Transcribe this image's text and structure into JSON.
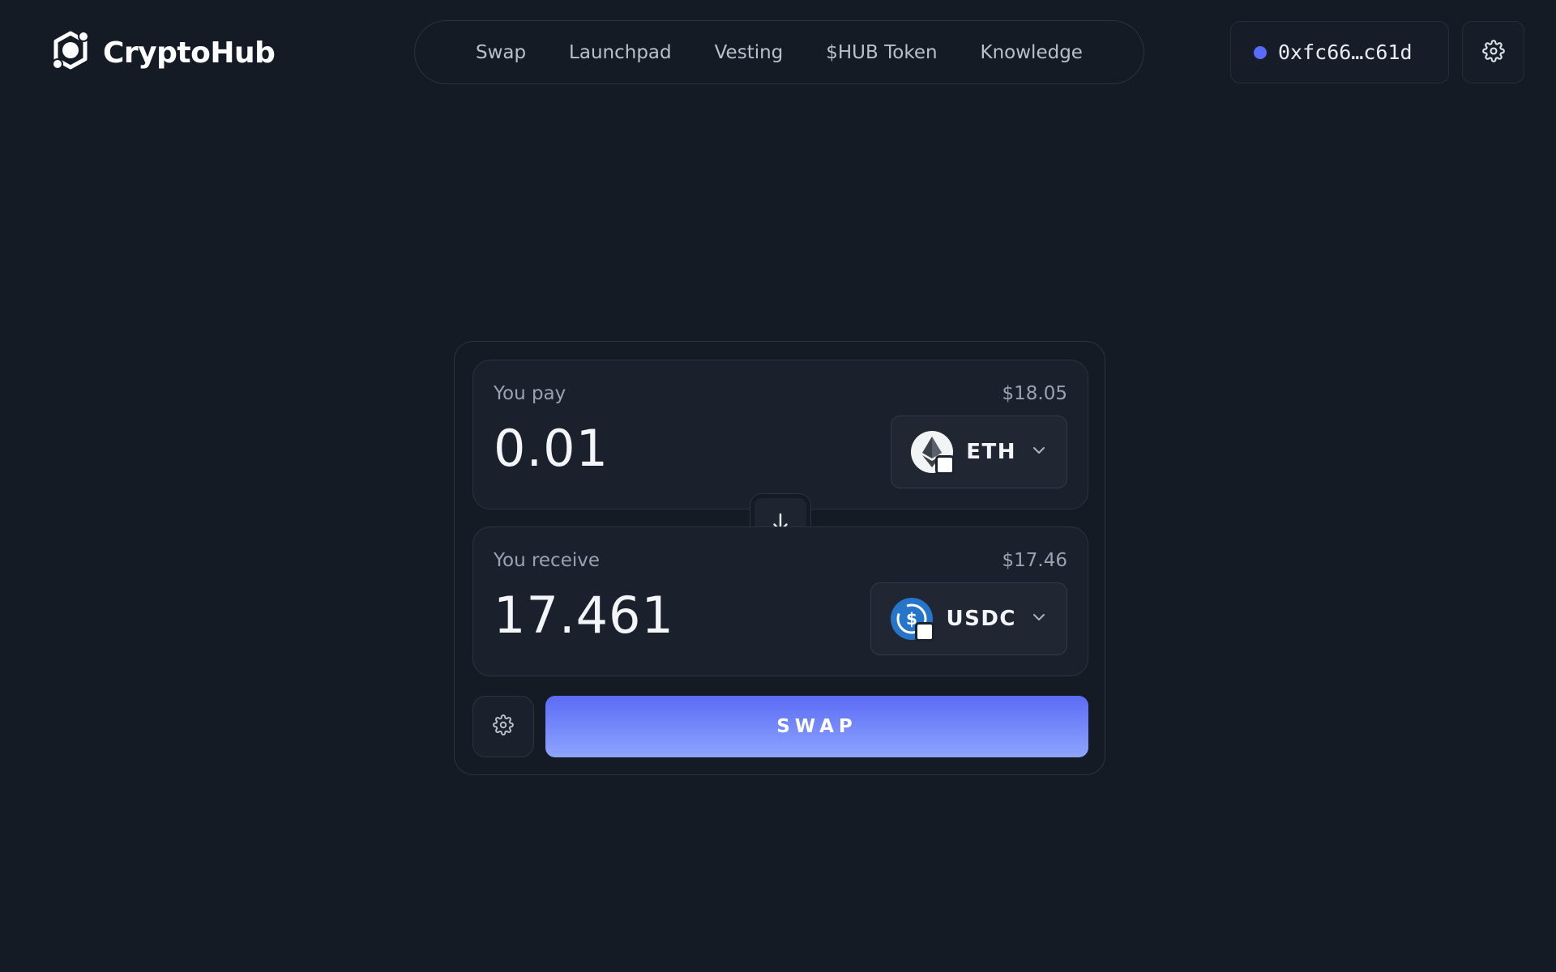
{
  "brand": {
    "name": "CryptoHub",
    "logo_icon": "cryptohub-logo-icon"
  },
  "nav": {
    "items": [
      {
        "label": "Swap"
      },
      {
        "label": "Launchpad"
      },
      {
        "label": "Vesting"
      },
      {
        "label": "$HUB Token"
      },
      {
        "label": "Knowledge"
      }
    ]
  },
  "wallet": {
    "address": "0xfc66…c61d",
    "status_color": "#5a6cff"
  },
  "header_settings": {
    "icon": "gear-icon"
  },
  "swap": {
    "pay": {
      "label": "You pay",
      "usd_value": "$18.05",
      "amount": "0.01",
      "token": {
        "symbol": "ETH",
        "icon": "eth-token-icon"
      }
    },
    "flip": {
      "icon": "arrow-down-icon"
    },
    "receive": {
      "label": "You receive",
      "usd_value": "$17.46",
      "amount": "17.461",
      "token": {
        "symbol": "USDC",
        "icon": "usdc-token-icon"
      }
    },
    "settings": {
      "icon": "gear-icon"
    },
    "button_label": "SWAP",
    "button_gradient": [
      "#5b6cf5",
      "#8ea4ff"
    ]
  },
  "colors": {
    "background": "#151b25",
    "panel": "#1b212c",
    "border": "#2c3340",
    "muted_text": "#9aa3b2"
  }
}
